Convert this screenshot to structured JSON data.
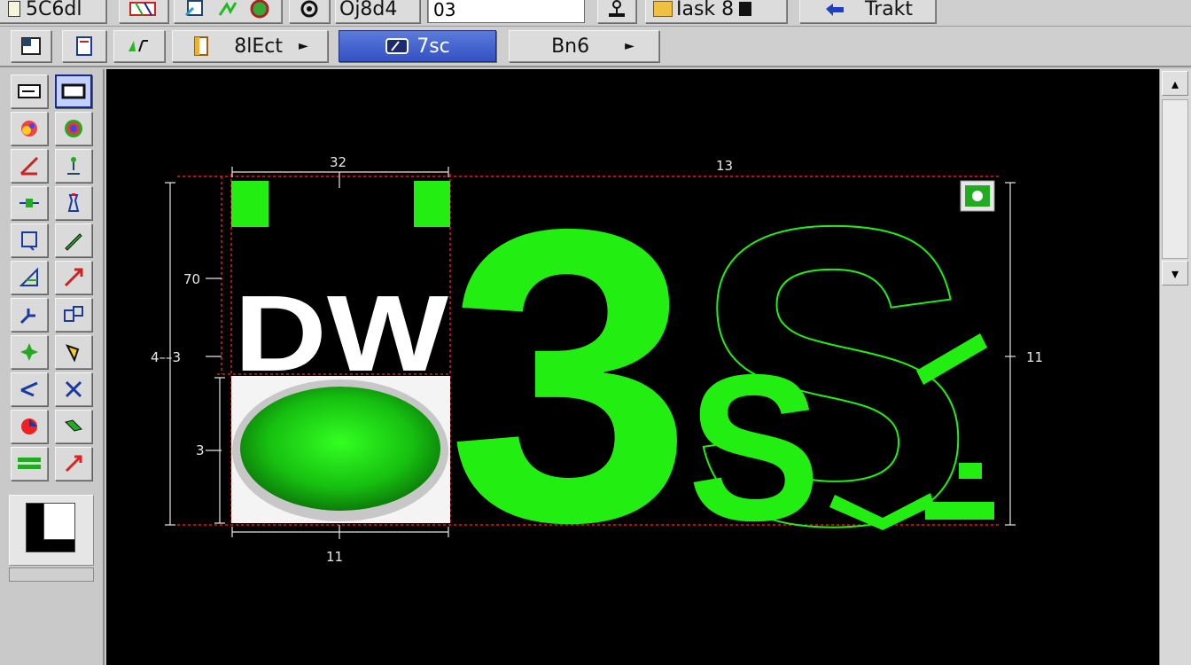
{
  "toolbar_top": {
    "file_label": "5C6dl",
    "object_label": "Oj8d4",
    "value_field": "03",
    "mask_label": "Iask  8",
    "track_label": "Trakt"
  },
  "toolbar_second": {
    "select_label": "8lEct",
    "fsc_label": "7sc",
    "bns_label": "Bn6"
  },
  "canvas": {
    "dimensions": {
      "top_left": "32",
      "top_right": "13",
      "left_upper": "70",
      "left_mid": "4––3",
      "left_lower": "3",
      "right": "11",
      "bottom": "11"
    },
    "artwork": {
      "text_dw": "DW",
      "text_3": "3",
      "text_s_outline": "S",
      "text_s": "S"
    }
  },
  "colors": {
    "accent_green": "#22ee11",
    "active_tab": "#3b57c4",
    "guide_red": "#d22222"
  },
  "icons": {
    "palette": [
      "rect-select-icon",
      "rect-select-filled-icon",
      "palette-icon",
      "color-wheel-icon",
      "angle-icon",
      "figure-icon",
      "align-icon",
      "bottle-icon",
      "crop-icon",
      "pen-icon",
      "triangle-icon",
      "arrow-icon",
      "step-icon",
      "grid-icon",
      "shape-icon",
      "lasso-icon",
      "vector-icon",
      "cross-icon",
      "fill-icon",
      "brush-icon",
      "rows-icon",
      "red-arrow-icon"
    ]
  }
}
